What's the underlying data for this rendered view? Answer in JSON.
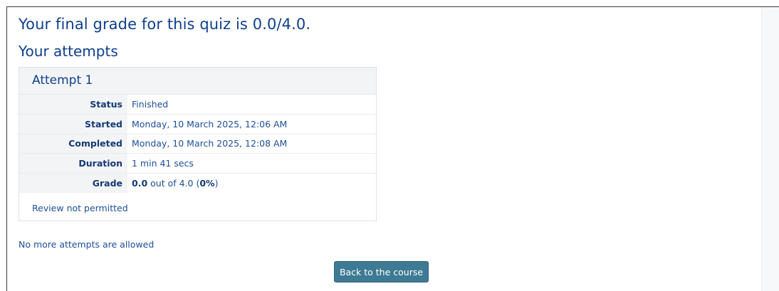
{
  "quiz": {
    "final_grade_text": "Your final grade for this quiz is 0.0/4.0.",
    "attempts_heading": "Your attempts"
  },
  "attempt": {
    "title": "Attempt 1",
    "rows": [
      {
        "label": "Status",
        "value": "Finished"
      },
      {
        "label": "Started",
        "value": "Monday, 10 March 2025, 12:06 AM"
      },
      {
        "label": "Completed",
        "value": "Monday, 10 March 2025, 12:08 AM"
      },
      {
        "label": "Duration",
        "value": "1 min 41 secs"
      }
    ],
    "grade": {
      "label": "Grade",
      "score": "0.0",
      "out_of_text": " out of 4.0 (",
      "percent": "0%",
      "close": ")"
    },
    "review_note": "Review not permitted"
  },
  "footer": {
    "no_more_attempts": "No more attempts are allowed",
    "back_button_label": "Back to the course"
  },
  "colors": {
    "heading": "#0f3f8c",
    "text": "#1d4f9a",
    "button_bg": "#3e7a93"
  }
}
